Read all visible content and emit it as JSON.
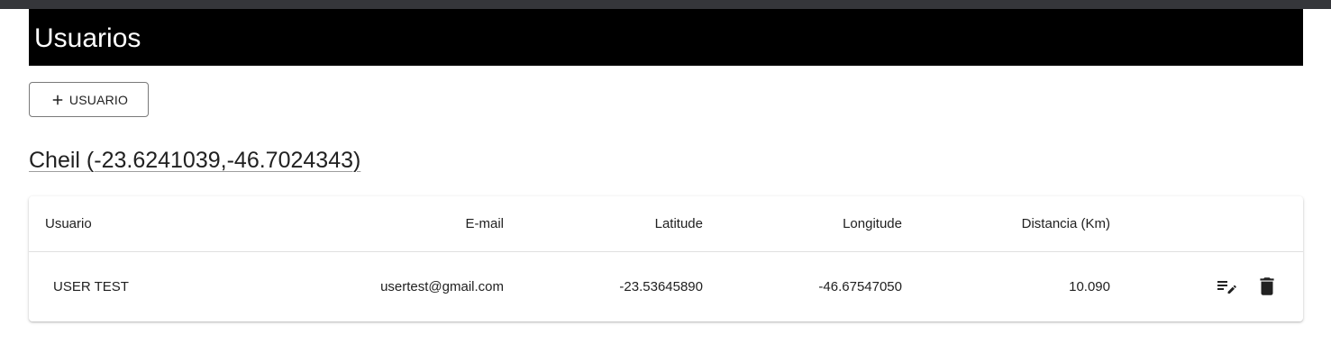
{
  "page": {
    "title": "Usuarios"
  },
  "toolbar": {
    "add_label": "USUARIO",
    "add_icon": "plus-icon"
  },
  "location": {
    "title": "Cheil (-23.6241039,-46.7024343)"
  },
  "table": {
    "headers": [
      "Usuario",
      "E-mail",
      "Latitude",
      "Longitude",
      "Distancia (Km)"
    ],
    "rows": [
      {
        "usuario": "USER TEST",
        "email": "usertest@gmail.com",
        "latitude": "-23.53645890",
        "longitude": "-46.67547050",
        "distancia": "10.090",
        "actions": [
          "edit-list-icon",
          "delete-trash-icon"
        ]
      }
    ]
  },
  "colors": {
    "header_bg": "#000000",
    "header_text": "#ffffff",
    "text": "#212121",
    "border": "#e0e0e0"
  }
}
